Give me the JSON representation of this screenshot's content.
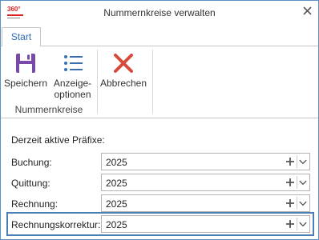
{
  "window": {
    "title": "Nummernkreise verwalten",
    "logo_text": "360°",
    "close_icon": "close-icon"
  },
  "tabs": [
    {
      "label": "Start",
      "active": true
    }
  ],
  "ribbon": {
    "buttons": {
      "save": {
        "label": "Speichern",
        "icon": "floppy-disk-icon",
        "color": "#7a4aa8"
      },
      "display": {
        "label_line1": "Anzeige-",
        "label_line2": "optionen",
        "icon": "list-icon",
        "color": "#3b6fb0"
      },
      "cancel": {
        "label": "Abbrechen",
        "icon": "x-icon",
        "color": "#d64a3a"
      }
    },
    "group_label": "Nummernkreise"
  },
  "content": {
    "section_label": "Derzeit aktive Präfixe:",
    "rows": [
      {
        "label": "Buchung:",
        "value": "2025"
      },
      {
        "label": "Quittung:",
        "value": "2025"
      },
      {
        "label": "Rechnung:",
        "value": "2025"
      },
      {
        "label": "Rechnungskorrektur:",
        "value": "2025"
      }
    ]
  }
}
